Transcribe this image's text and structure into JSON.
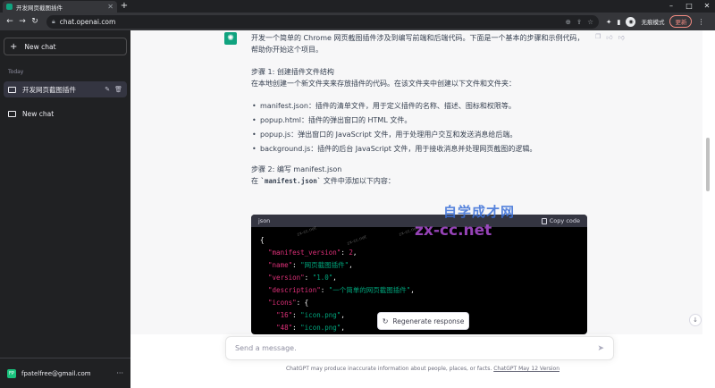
{
  "browser": {
    "tab_title": "开发网页截图插件",
    "url": "chat.openai.com",
    "profile_label": "无痕模式",
    "update_label": "更新"
  },
  "sidebar": {
    "new_chat_label": "New chat",
    "section_label": "Today",
    "items": [
      {
        "label": "开发网页截图插件",
        "active": true
      },
      {
        "label": "New chat",
        "active": false
      }
    ],
    "user_email": "fpatelfree@gmail.com",
    "user_initials": "FP"
  },
  "message": {
    "intro": "开发一个简单的 Chrome 网页截图插件涉及到编写前端和后端代码。下面是一个基本的步骤和示例代码，帮助你开始这个项目。",
    "step1_title": "步骤 1: 创建插件文件结构",
    "step1_desc": "在本地创建一个新文件夹来存放插件的代码。在该文件夹中创建以下文件和文件夹：",
    "files": [
      {
        "name": "manifest.json",
        "desc": "：插件的清单文件，用于定义插件的名称、描述、图标和权限等。"
      },
      {
        "name": "popup.html",
        "desc": "：插件的弹出窗口的 HTML 文件。"
      },
      {
        "name": "popup.js",
        "desc": "：弹出窗口的 JavaScript 文件，用于处理用户交互和发送消息给后端。"
      },
      {
        "name": "background.js",
        "desc": "：插件的后台 JavaScript 文件，用于接收消息并处理网页截图的逻辑。"
      }
    ],
    "step2_title": "步骤 2: 编写 manifest.json",
    "step2_pre": "在 ",
    "step2_code": "`manifest.json`",
    "step2_post": " 文件中添加以下内容："
  },
  "code_block": {
    "language": "json",
    "copy_label": "Copy code",
    "lines": [
      {
        "indent": "",
        "key": "",
        "punct": "{",
        "value": "",
        "tail": ""
      },
      {
        "indent": "  ",
        "key": "\"manifest_version\"",
        "punct": ": ",
        "value": "2",
        "tail": ","
      },
      {
        "indent": "  ",
        "key": "\"name\"",
        "punct": ": ",
        "value": "\"网页截图插件\"",
        "tail": ","
      },
      {
        "indent": "  ",
        "key": "\"version\"",
        "punct": ": ",
        "value": "\"1.0\"",
        "tail": ","
      },
      {
        "indent": "  ",
        "key": "\"description\"",
        "punct": ": ",
        "value": "\"一个简单的网页截图插件\"",
        "tail": ","
      },
      {
        "indent": "  ",
        "key": "\"icons\"",
        "punct": ": ",
        "value": "",
        "tail": "{"
      },
      {
        "indent": "    ",
        "key": "\"16\"",
        "punct": ": ",
        "value": "\"icon.png\"",
        "tail": ","
      },
      {
        "indent": "    ",
        "key": "\"48\"",
        "punct": ": ",
        "value": "\"icon.png\"",
        "tail": ","
      }
    ]
  },
  "regenerate_label": "Regenerate response",
  "composer": {
    "placeholder": "Send a message."
  },
  "disclaimer": {
    "text": "ChatGPT may produce inaccurate information about people, places, or facts. ",
    "version": "ChatGPT May 12 Version"
  },
  "watermark": {
    "line1": "自学成才网",
    "line2": "zx-cc.net",
    "faint": "zx-cc.net"
  },
  "colors": {
    "sidebar_bg": "#202123",
    "brand_green": "#10a37f",
    "code_bg": "#000000",
    "code_key": "#df3079",
    "code_string": "#00a67d"
  }
}
